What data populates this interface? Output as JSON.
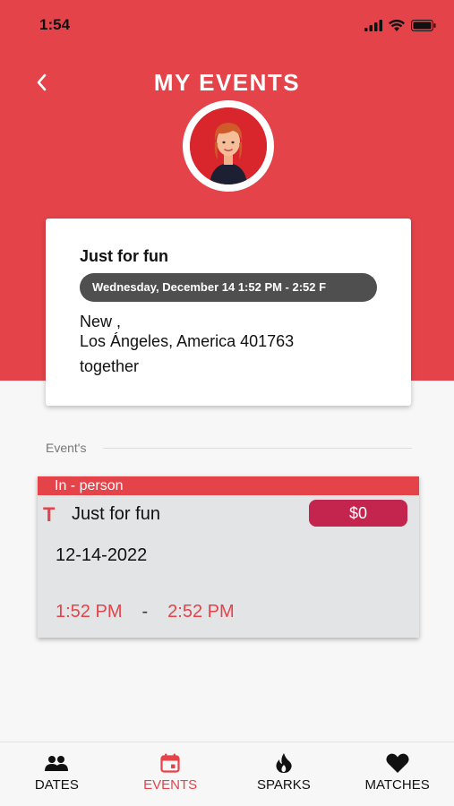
{
  "status_bar": {
    "time": "1:54"
  },
  "header": {
    "title": "MY EVENTS"
  },
  "event_card": {
    "title": "Just for fun",
    "datetime": "Wednesday, December 14 1:52 PM - 2:52 F",
    "address_line1": "New ,",
    "address_line2": "Los Ángeles, America 401763",
    "note": "together"
  },
  "section": {
    "label": "Event's"
  },
  "event_list": [
    {
      "mode": "In - person",
      "type_icon": "T",
      "title": "Just for fun",
      "price": "$0",
      "date": "12-14-2022",
      "start_time": "1:52 PM",
      "separator": "-",
      "end_time": "2:52 PM"
    }
  ],
  "bottom_nav": [
    {
      "label": "DATES",
      "icon": "people-icon"
    },
    {
      "label": "EVENTS",
      "icon": "calendar-icon",
      "active": true
    },
    {
      "label": "SPARKS",
      "icon": "flame-icon"
    },
    {
      "label": "MATCHES",
      "icon": "heart-icon"
    }
  ],
  "colors": {
    "accent": "#e5434a",
    "price_badge": "#c4254f",
    "date_pill": "#4f4f4f"
  }
}
